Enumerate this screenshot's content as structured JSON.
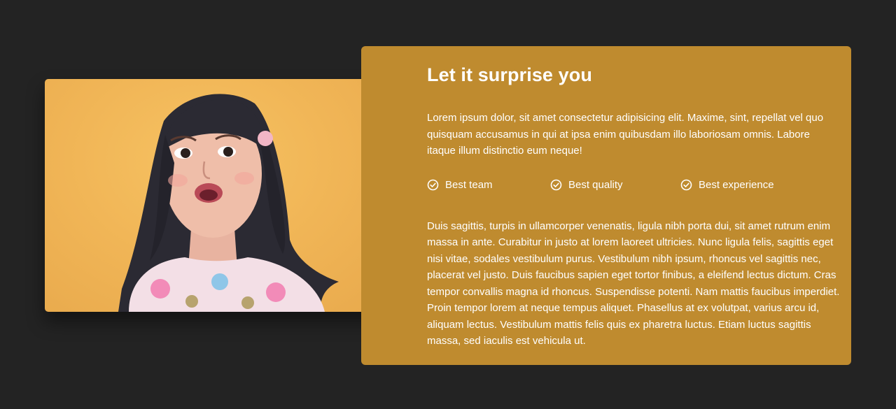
{
  "section": {
    "title": "Let it surprise you",
    "intro": "Lorem ipsum dolor, sit amet consectetur adipisicing elit. Maxime, sint, repellat vel quo quisquam accusamus in qui at ipsa enim quibusdam illo laboriosam omnis. Labore itaque illum distinctio eum neque!",
    "features": [
      {
        "label": "Best team",
        "icon": "check-circle-icon"
      },
      {
        "label": "Best quality",
        "icon": "check-circle-icon"
      },
      {
        "label": "Best experience",
        "icon": "check-circle-icon"
      }
    ],
    "body": "Duis sagittis, turpis in ullamcorper venenatis, ligula nibh porta dui, sit amet rutrum enim massa in ante. Curabitur in justo at lorem laoreet ultricies. Nunc ligula felis, sagittis eget nisi vitae, sodales vestibulum purus. Vestibulum nibh ipsum, rhoncus vel sagittis nec, placerat vel justo. Duis faucibus sapien eget tortor finibus, a eleifend lectus dictum. Cras tempor convallis magna id rhoncus. Suspendisse potenti. Nam mattis faucibus imperdiet. Proin tempor lorem at neque tempus aliquet. Phasellus at ex volutpat, varius arcu id, aliquam lectus. Vestibulum mattis felis quis ex pharetra luctus. Etiam luctus sagittis massa, sed iaculis est vehicula ut."
  },
  "colors": {
    "page_background": "#232323",
    "panel_background": "#bf8b2f",
    "text": "#ffffff",
    "photo_background": "#f1b657"
  }
}
